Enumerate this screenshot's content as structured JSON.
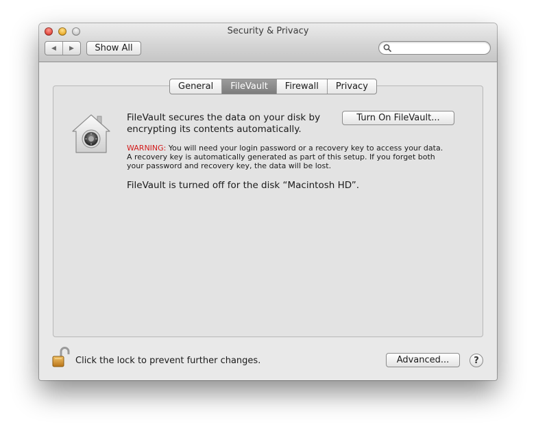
{
  "window": {
    "title": "Security & Privacy"
  },
  "toolbar": {
    "back_glyph": "◀",
    "forward_glyph": "▶",
    "show_all_label": "Show All",
    "search_placeholder": ""
  },
  "tabs": [
    {
      "label": "General",
      "active": false
    },
    {
      "label": "FileVault",
      "active": true
    },
    {
      "label": "Firewall",
      "active": false
    },
    {
      "label": "Privacy",
      "active": false
    }
  ],
  "filevault": {
    "description": "FileVault secures the data on your disk by encrypting its contents automatically.",
    "turn_on_label": "Turn On FileVault...",
    "warning_prefix": "WARNING:",
    "warning_text": " You will need your login password or a recovery key to access your data. A recovery key is automatically generated as part of this setup. If you forget both your password and recovery key, the data will be lost.",
    "status": "FileVault is turned off for the disk “Macintosh HD”."
  },
  "footer": {
    "lock_text": "Click the lock to prevent further changes.",
    "advanced_label": "Advanced...",
    "help_label": "?"
  },
  "colors": {
    "warning": "#d21a1a",
    "active_tab": "#8a8a8a"
  },
  "icons": {
    "close": "close-icon",
    "minimize": "minimize-icon",
    "zoom": "zoom-icon",
    "search": "search-icon",
    "filevault": "filevault-house-icon",
    "lock": "lock-open-icon"
  }
}
